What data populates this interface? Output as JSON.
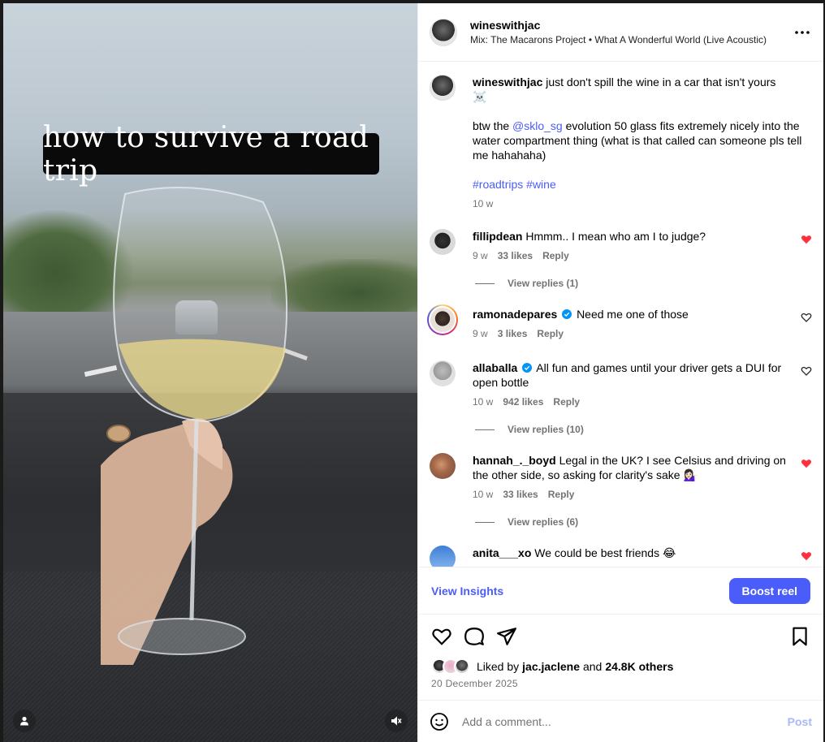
{
  "media": {
    "overlay_text": "how to survive a road trip"
  },
  "header": {
    "username": "wineswithjac",
    "audio": "Mix: The Macarons Project • What A Wonderful World (Live Acoustic)"
  },
  "caption": {
    "username": "wineswithjac",
    "text_1": "just don't spill the wine in a car that isn't yours",
    "emoji_1": "☠️",
    "text_2_before": "btw the ",
    "mention": "@sklo_sg",
    "text_2_after": " evolution 50 glass fits extremely nicely into the water compartment thing (what is that called can someone pls tell me hahahaha)",
    "hashtag_1": "#roadtrips",
    "hashtag_2": "#wine",
    "time": "10 w"
  },
  "comments": [
    {
      "username": "fillipdean",
      "text": "Hmmm.. I mean who am I to judge?",
      "time": "9 w",
      "likes": "33 likes",
      "reply": "Reply",
      "view_replies": "View replies (1)",
      "liked": true,
      "verified": false
    },
    {
      "username": "ramonadepares",
      "text": "Need me one of those",
      "time": "9 w",
      "likes": "3 likes",
      "reply": "Reply",
      "view_replies": "",
      "liked": false,
      "verified": true
    },
    {
      "username": "allaballa",
      "text": "All fun and games until your driver gets a DUI for open bottle",
      "time": "10 w",
      "likes": "942 likes",
      "reply": "Reply",
      "view_replies": "View replies (10)",
      "liked": false,
      "verified": true
    },
    {
      "username": "hannah_._boyd",
      "text": "Legal in the UK? I see Celsius and driving on the other side, so asking for clarity's sake 💁🏻‍♀️",
      "time": "10 w",
      "likes": "33 likes",
      "reply": "Reply",
      "view_replies": "View replies (6)",
      "liked": true,
      "verified": false
    },
    {
      "username": "anita___xo",
      "text": "We could be best friends 😂",
      "liked": true
    }
  ],
  "insights": {
    "link": "View Insights",
    "boost": "Boost reel"
  },
  "likes": {
    "prefix": "Liked by ",
    "user": "jac.jaclene",
    "middle": " and ",
    "others": "24.8K others"
  },
  "date": "20 December 2025",
  "add_comment": {
    "placeholder": "Add a comment...",
    "post": "Post"
  },
  "colors": {
    "accent": "#4a5df9",
    "like_red": "#ff3040",
    "muted": "#737373"
  }
}
